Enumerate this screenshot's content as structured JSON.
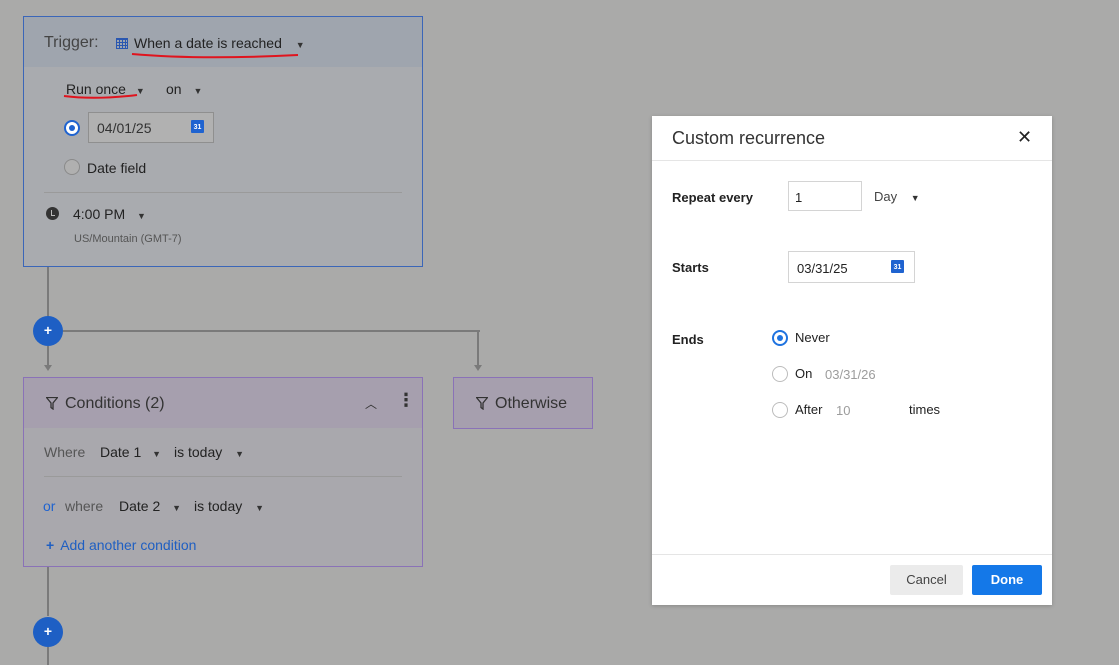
{
  "trigger": {
    "label": "Trigger:",
    "type": "When a date is reached",
    "run": "Run once",
    "on": "on",
    "date_value": "04/01/25",
    "date_field": "Date field",
    "time": "4:00 PM",
    "timezone": "US/Mountain (GMT-7)"
  },
  "conditions": {
    "title": "Conditions (2)",
    "rows": [
      {
        "prefix": "Where",
        "field": "Date 1",
        "operator": "is today"
      },
      {
        "connector": "or",
        "prefix": "where",
        "field": "Date 2",
        "operator": "is today"
      }
    ],
    "add_label": "Add another condition"
  },
  "otherwise": {
    "title": "Otherwise"
  },
  "flow": {
    "add_symbol": "+"
  },
  "modal": {
    "title": "Custom recurrence",
    "repeat_label": "Repeat every",
    "repeat_value": "1",
    "repeat_unit": "Day",
    "starts_label": "Starts",
    "starts_value": "03/31/25",
    "ends_label": "Ends",
    "ends_options": {
      "never": "Never",
      "on": "On",
      "on_date": "03/31/26",
      "after": "After",
      "after_count": "10",
      "times": "times"
    },
    "selected_end": "never",
    "cancel": "Cancel",
    "done": "Done"
  },
  "colors": {
    "accent": "#1478e8",
    "annotation_red": "#e0141e",
    "overlay": "#aaaaa9"
  },
  "icons": [
    "calendar-icon",
    "clock-icon",
    "filter-icon",
    "chevron-up-icon",
    "kebab-menu-icon",
    "close-icon",
    "plus-icon"
  ]
}
